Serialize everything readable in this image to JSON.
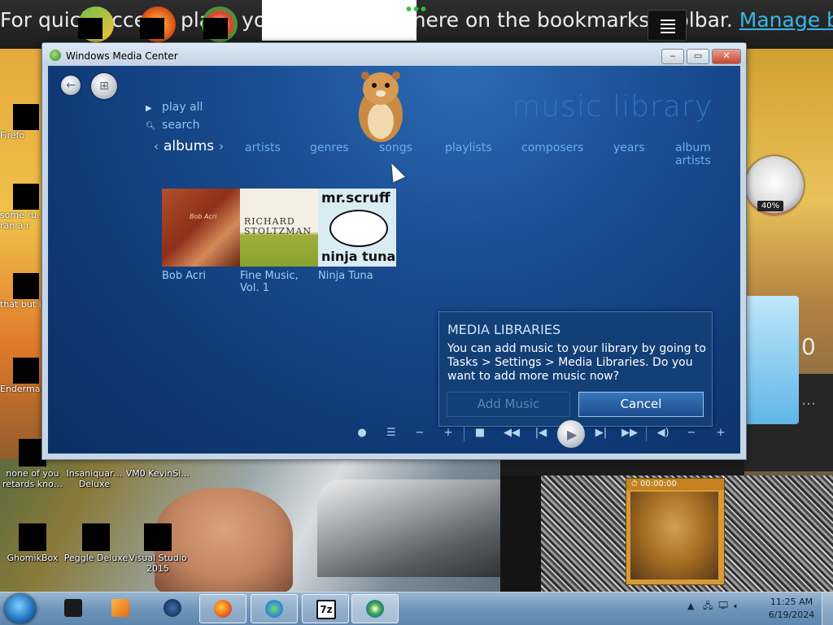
{
  "browser_bar": {
    "text": "For quick access, place your bookmarks here on the bookmarks toolbar. ",
    "link": "Manage bookmarks…"
  },
  "window": {
    "title": "Windows Media Center",
    "buttons": {
      "minimize": "‒",
      "restore": "▭",
      "close": "✕"
    }
  },
  "media_center": {
    "library_title": "music library",
    "side_menu": [
      {
        "label": "play all",
        "icon": "play-icon"
      },
      {
        "label": "search",
        "icon": "search-icon"
      }
    ],
    "active_category": "albums",
    "categories": [
      "artists",
      "genres",
      "songs",
      "playlists",
      "composers",
      "years",
      "album artists"
    ],
    "albums": [
      {
        "title": "Bob Acri",
        "cover_text": "Bob Acri"
      },
      {
        "title": "Fine Music, Vol. 1",
        "cover_text_1": "RICHARD",
        "cover_text_2": "STOLTZMAN"
      },
      {
        "title": "Ninja Tuna",
        "cover_text_1": "mr.scruff",
        "cover_text_2": "ninja tuna"
      }
    ],
    "dialog": {
      "title": "MEDIA LIBRARIES",
      "body": "You can add music to your library by going to Tasks > Settings > Media Libraries. Do you want to add more music now?",
      "add_label": "Add Music",
      "cancel_label": "Cancel"
    },
    "transport_icons": [
      "record-icon",
      "list-icon",
      "channel-down-icon",
      "channel-up-icon",
      "stop-icon",
      "rewind-icon",
      "previous-icon",
      "play-icon",
      "next-icon",
      "fast-forward-icon",
      "mute-icon",
      "volume-down-icon",
      "volume-up-icon"
    ]
  },
  "desktop_icons": {
    "left": [
      "Firefo",
      "some ru… ran a r",
      "that but i",
      "Enderma"
    ],
    "bottom_row1": [
      "none of you retards kno…",
      "Insaniquar… Deluxe",
      "VM0 KevinSi…"
    ],
    "bottom_row2": [
      "GhomikBox",
      "Peggle Deluxe",
      "Visual Studio 2015"
    ]
  },
  "gadgets": {
    "cpu_meter": "40%",
    "right_panel_digit": "0",
    "right_dots": "…",
    "robot_timer": "00:00:00"
  },
  "taskbar": {
    "items": [
      "file-explorer-icon",
      "media-player-icon",
      "app-icon",
      "firefox-icon",
      "messenger-icon",
      "7zip-icon",
      "media-center-icon"
    ],
    "sevenzip_label": "7z",
    "time": "11:25 AM",
    "date": "6/19/2024"
  },
  "colors": {
    "wmc_accent": "#8cc6ef",
    "dialog_bg": "#143f77",
    "cancel_button": "#2e6aae"
  }
}
